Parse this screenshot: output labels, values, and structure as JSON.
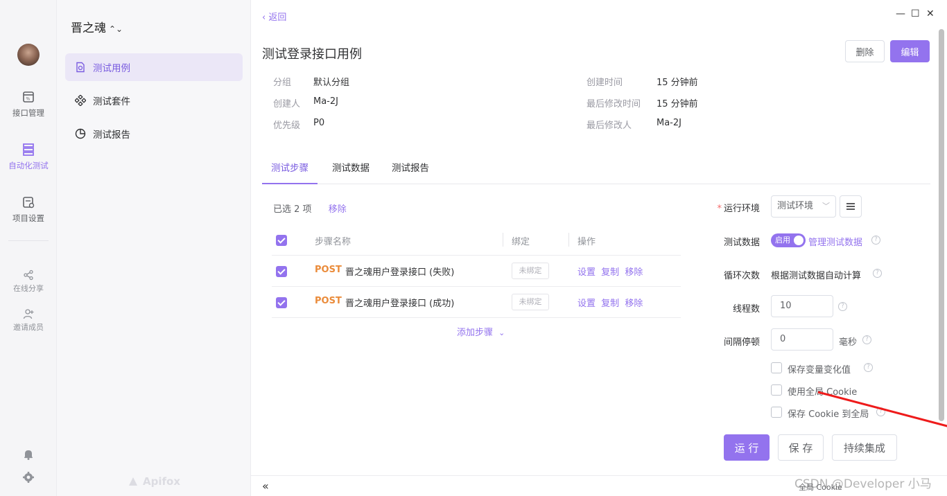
{
  "rail": {
    "items": [
      {
        "label": "接口管理",
        "icon": "api-icon"
      },
      {
        "label": "自动化测试",
        "icon": "automation-icon"
      },
      {
        "label": "项目设置",
        "icon": "settings-doc-icon"
      }
    ],
    "share_label": "在线分享",
    "invite_label": "邀请成员"
  },
  "subnav": {
    "project_name": "晋之魂",
    "project_chevron": "⌃⌄",
    "items": [
      {
        "label": "测试用例"
      },
      {
        "label": "测试套件"
      },
      {
        "label": "测试报告"
      }
    ],
    "brand": "Apifox"
  },
  "header": {
    "back_label": "返回",
    "back_chevron": "‹",
    "title": "测试登录接口用例",
    "delete_label": "删除",
    "edit_label": "编辑"
  },
  "meta": {
    "group_label": "分组",
    "group_value": "默认分组",
    "creator_label": "创建人",
    "creator_value": "Ma-2J",
    "priority_label": "优先级",
    "priority_value": "P0",
    "created_label": "创建时间",
    "created_value": "15 分钟前",
    "modified_label": "最后修改时间",
    "modified_value": "15 分钟前",
    "modifier_label": "最后修改人",
    "modifier_value": "Ma-2J"
  },
  "tabs": [
    {
      "label": "测试步骤"
    },
    {
      "label": "测试数据"
    },
    {
      "label": "测试报告"
    }
  ],
  "steps": {
    "selected_text": "已选 2 项",
    "remove_label": "移除",
    "col_name": "步骤名称",
    "col_bind": "绑定",
    "col_ops": "操作",
    "rows": [
      {
        "method": "POST",
        "name": "晋之魂用户登录接口 (失败)",
        "bind": "未绑定",
        "op1": "设置",
        "op2": "复制",
        "op3": "移除"
      },
      {
        "method": "POST",
        "name": "晋之魂用户登录接口 (成功)",
        "bind": "未绑定",
        "op1": "设置",
        "op2": "复制",
        "op3": "移除"
      }
    ],
    "add_step_label": "添加步骤",
    "add_step_chevron": "⌄"
  },
  "run_panel": {
    "env_required": "*",
    "env_label": "运行环境",
    "env_value": "测试环境",
    "env_arrow": "﹀",
    "data_label": "测试数据",
    "data_toggle": "启用",
    "manage_data": "管理测试数据",
    "loop_label": "循环次数",
    "loop_value": "根据测试数据自动计算",
    "threads_label": "线程数",
    "threads_value": "10",
    "interval_label": "间隔停顿",
    "interval_value": "0",
    "interval_unit": "毫秒",
    "opt1": "保存变量变化值",
    "opt2": "使用全局 Cookie",
    "opt3": "保存 Cookie 到全局",
    "help_glyph": "?",
    "run_label": "运 行",
    "save_label": "保 存",
    "ci_label": "持续集成"
  },
  "bottom": {
    "collapse": "«",
    "cookie": "全局 Cookie",
    "watermark": "CSDN @Developer 小马"
  },
  "window": {
    "minimize": "—",
    "maximize": "☐",
    "close": "✕"
  },
  "colors": {
    "accent": "#9373ee",
    "post": "#ea8b3a"
  }
}
